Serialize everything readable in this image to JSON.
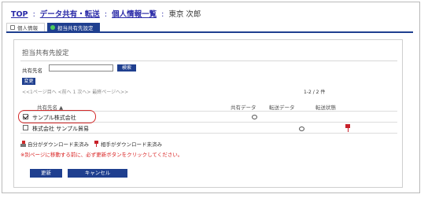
{
  "breadcrumb": {
    "top": "TOP",
    "data_share": "データ共有・転送",
    "personal_list": "個人情報一覧",
    "current": "東京 次郎",
    "separator": ":"
  },
  "tabs": {
    "personal_info": "個人情報",
    "assignee_share": "担当共有先設定"
  },
  "panel": {
    "title": "担当共有先設定",
    "search_label": "共有先名",
    "search_value": "",
    "search_button": "検索",
    "change_button": "変更",
    "pager": "<<1ページ目へ <前へ 1 次へ> 最終ページへ>>",
    "count": "1-2 / 2 件"
  },
  "table": {
    "headers": {
      "name": "共有先名 ▲",
      "shared_data": "共有データ",
      "transfer_data": "転送データ",
      "transfer_status": "転送状態"
    },
    "rows": [
      {
        "name": "サンプル株式会社",
        "checked": true
      },
      {
        "name": "株式会社 サンプル貿易",
        "checked": false
      }
    ]
  },
  "legend": {
    "self_not_downloaded": "自分がダウンロード未済み",
    "partner_not_downloaded": "相手がダウンロード未済み"
  },
  "notice": "※別ページに移動する前に、必ず更新ボタンをクリックしてください。",
  "buttons": {
    "update": "更新",
    "cancel": "キャンセル"
  },
  "colors": {
    "accent": "#1f3f8f",
    "alert": "#d81d1d",
    "status_icon": "#c8202a"
  }
}
